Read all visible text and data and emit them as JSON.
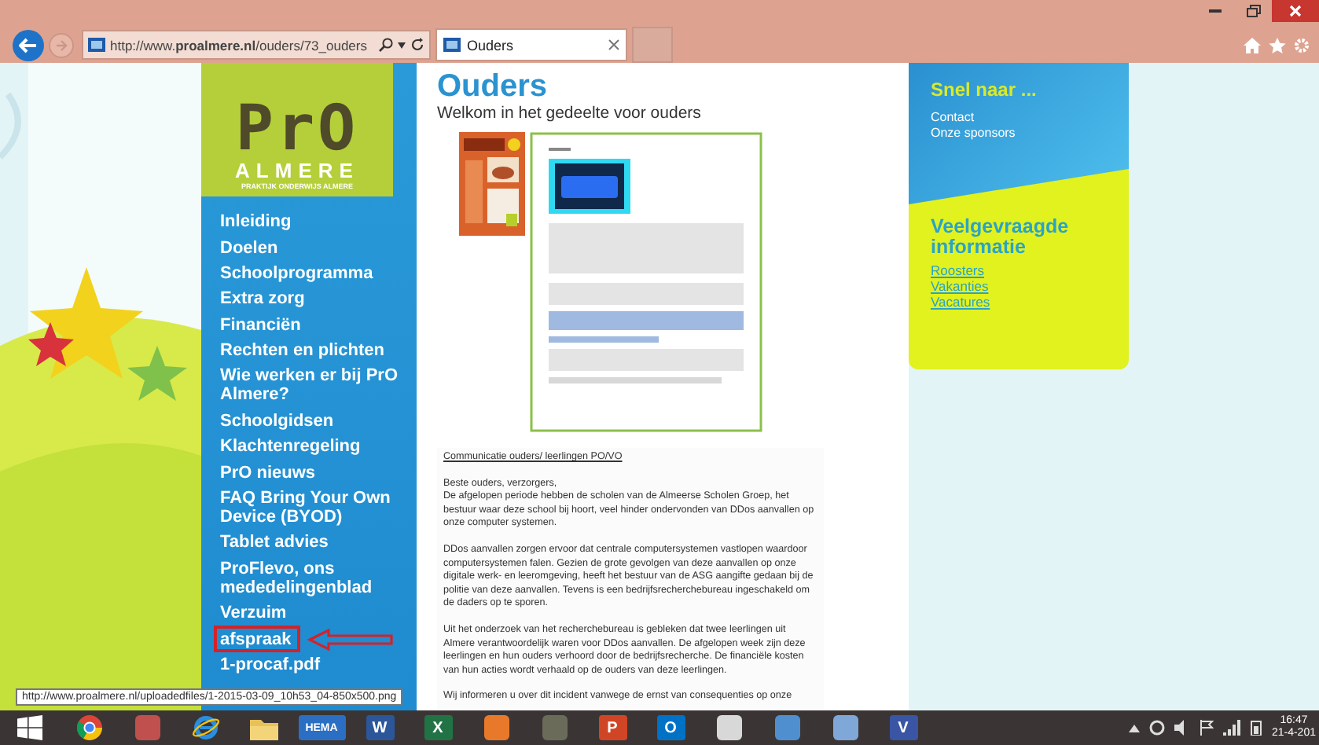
{
  "browser": {
    "url": "http://www.**proalmere.nl**/ouders/73_ouders",
    "tab": {
      "title": "Ouders",
      "selected": true
    }
  },
  "logo": {
    "title": "PrO",
    "subtitle": "ALMERE",
    "tagline": "PRAKTIJK ONDERWIJS ALMERE"
  },
  "nav": [
    {
      "label": "Inleiding",
      "highlighted": false
    },
    {
      "label": "Doelen",
      "highlighted": false
    },
    {
      "label": "Schoolprogramma",
      "highlighted": false
    },
    {
      "label": "Extra zorg",
      "highlighted": false
    },
    {
      "label": "Financiën",
      "highlighted": false
    },
    {
      "label": "Rechten en plichten",
      "highlighted": false
    },
    {
      "label": "Wie werken er bij PrO Almere?",
      "highlighted": false
    },
    {
      "label": "Schoolgidsen",
      "highlighted": false
    },
    {
      "label": "Klachtenregeling",
      "highlighted": false
    },
    {
      "label": "PrO nieuws",
      "highlighted": false
    },
    {
      "label": "FAQ Bring Your Own Device (BYOD)",
      "highlighted": false
    },
    {
      "label": "Tablet advies",
      "highlighted": false
    },
    {
      "label": "ProFlevo, ons mededelingenblad",
      "highlighted": false
    },
    {
      "label": "Verzuim",
      "highlighted": false
    },
    {
      "label": "afspraak",
      "highlighted": true
    },
    {
      "label": "1-procaf.pdf",
      "highlighted": false
    }
  ],
  "page": {
    "title": "Ouders",
    "subtitle": "Welkom in het gedeelte voor ouders",
    "letter": {
      "heading": "Communicatie ouders/ leerlingen PO/VO",
      "paragraphs": [
        "Beste ouders, verzorgers,\nDe afgelopen periode hebben de scholen van de Almeerse Scholen Groep, het bestuur waar deze school bij hoort, veel hinder ondervonden van DDos aanvallen op onze computer systemen.",
        "DDos aanvallen zorgen ervoor dat centrale computersystemen vastlopen waardoor computersystemen falen. Gezien de grote gevolgen van deze aanvallen op onze digitale werk- en leeromgeving, heeft het bestuur van de ASG aangifte gedaan bij de politie van deze aanvallen. Tevens is een bedrijfsrecherchebureau ingeschakeld om de daders op te sporen.",
        "Uit het onderzoek van het recherchebureau is gebleken dat twee leerlingen uit Almere verantwoordelijk waren voor DDos aanvallen. De afgelopen week zijn deze leerlingen en hun ouders verhoord door de bedrijfsrecherche. De financiële kosten van hun acties wordt verhaald op de ouders van deze leerlingen.",
        "Wij informeren u over dit incident vanwege de ernst van consequenties op onze"
      ]
    }
  },
  "quick_links": {
    "title": "Snel naar ...",
    "items": [
      "Contact",
      "Onze sponsors"
    ]
  },
  "faq": {
    "title": "Veelgevraagde informatie",
    "links": [
      "Roosters",
      "Vakanties",
      "Vacatures"
    ]
  },
  "status_tooltip": "http://www.proalmere.nl/uploadedfiles/1-2015-03-09_10h53_04-850x500.png",
  "taskbar": {
    "apps": [
      {
        "kind": "chrome"
      },
      {
        "kind": "misc",
        "color": "#c0504d"
      },
      {
        "kind": "ie"
      },
      {
        "kind": "folder"
      },
      {
        "kind": "tile",
        "label": "HEMA",
        "color": "#2a6fc4"
      },
      {
        "kind": "tile",
        "label": "W",
        "color": "#2b579a"
      },
      {
        "kind": "tile",
        "label": "X",
        "color": "#217346"
      },
      {
        "kind": "misc",
        "color": "#e8792b"
      },
      {
        "kind": "misc",
        "color": "#6b6b5a"
      },
      {
        "kind": "tile",
        "label": "P",
        "color": "#d04525"
      },
      {
        "kind": "tile",
        "label": "O",
        "color": "#0072c6"
      },
      {
        "kind": "misc",
        "color": "#d8d8d8"
      },
      {
        "kind": "misc",
        "color": "#4f8fd0"
      },
      {
        "kind": "misc",
        "color": "#7fa7d8"
      },
      {
        "kind": "tile",
        "label": "V",
        "color": "#3955a3"
      }
    ],
    "clock": {
      "time": "16:47",
      "date": "21-4-201"
    }
  }
}
